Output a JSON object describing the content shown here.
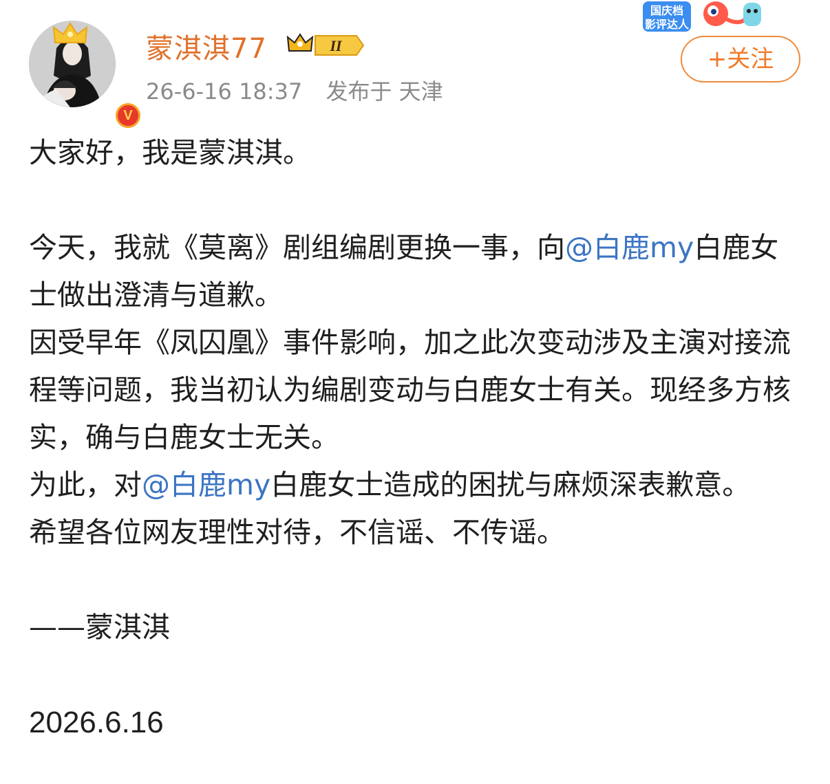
{
  "user": {
    "name": "蒙淇淇77",
    "vip_level": "II",
    "verified_badge": "V"
  },
  "meta": {
    "time": "26-6-16 18:37",
    "location": "发布于 天津"
  },
  "event_badge": {
    "line1": "国庆档",
    "line2": "影评达人"
  },
  "follow_button": "+关注",
  "post": {
    "greeting": "大家好，我是蒙淇淇。",
    "p1_before": "今天，我就《莫离》剧组编剧更换一事，向",
    "mention1": "@白鹿my",
    "p1_after": "白鹿女士做出澄清与道歉。",
    "p2": "因受早年《凤囚凰》事件影响，加之此次变动涉及主演对接流程等问题，我当初认为编剧变动与白鹿女士有关。现经多方核实，确与白鹿女士无关。",
    "p3_before": "为此，对",
    "mention2": "@白鹿my",
    "p3_after": "白鹿女士造成的困扰与麻烦深表歉意。",
    "p4": "希望各位网友理性对待，不信谣、不传谣。",
    "signature": "——蒙淇淇",
    "date": "2026.6.16"
  },
  "colors": {
    "username": "#e0702a",
    "mention": "#3b74c4",
    "follow": "#f07a28",
    "meta": "#8a8a8a"
  },
  "icons": [
    "crown-icon",
    "verified-v-icon",
    "vip-crown-badge-icon",
    "event-badge-icon"
  ]
}
